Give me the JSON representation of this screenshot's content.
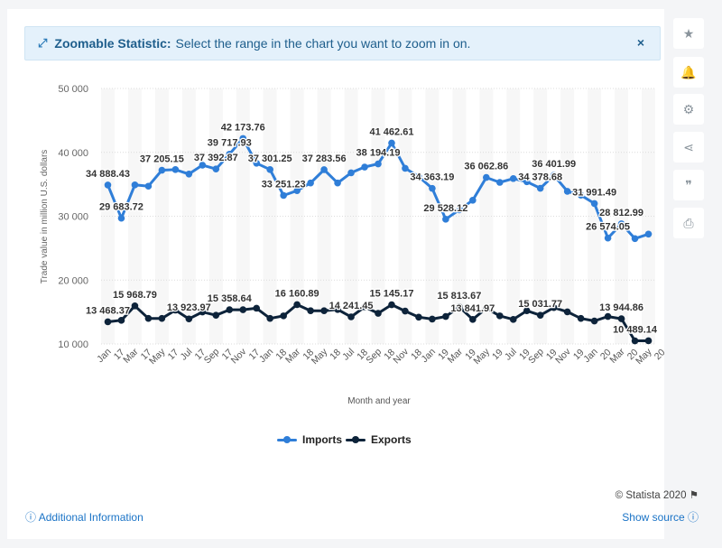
{
  "banner": {
    "title": "Zoomable Statistic:",
    "text": "Select the range in the chart you want to zoom in on.",
    "close": "×"
  },
  "sidebar": {
    "star": "★",
    "bell": "🔔",
    "gear": "⚙",
    "share": "⋖",
    "quote": "❞",
    "print": "⎙"
  },
  "footer": {
    "copyright": "© Statista 2020",
    "flag": "⚑",
    "additional_info": "Additional Information",
    "show_source": "Show source"
  },
  "colors": {
    "imports": "#2f7ed8",
    "exports": "#0d233a"
  },
  "chart_data": {
    "type": "line",
    "title": "",
    "xlabel": "Month and year",
    "ylabel": "Trade value in million U.S. dollars",
    "ylim": [
      10000,
      50000
    ],
    "yticks": [
      10000,
      20000,
      30000,
      40000,
      50000
    ],
    "ytick_labels": [
      "10 000",
      "20 000",
      "30 000",
      "40 000",
      "50 000"
    ],
    "categories": [
      "Jan 17",
      "Feb 17",
      "Mar 17",
      "Apr 17",
      "May 17",
      "Jun 17",
      "Jul 17",
      "Aug 17",
      "Sep 17",
      "Oct 17",
      "Nov 17",
      "Dec 17",
      "Jan 18",
      "Feb 18",
      "Mar 18",
      "Apr 18",
      "May 18",
      "Jun 18",
      "Jul 18",
      "Aug 18",
      "Sep 18",
      "Oct 18",
      "Nov 18",
      "Dec 18",
      "Jan 19",
      "Feb 19",
      "Mar 19",
      "Apr 19",
      "May 19",
      "Jun 19",
      "Jul 19",
      "Aug 19",
      "Sep 19",
      "Oct 19",
      "Nov 19",
      "Dec 19",
      "Jan 20",
      "Feb 20",
      "Mar 20",
      "Apr 20",
      "May 20"
    ],
    "xtick_labels": [
      [
        "Jan",
        "17"
      ],
      [
        "Mar",
        "17"
      ],
      [
        "May",
        "17"
      ],
      [
        "Jul",
        "17"
      ],
      [
        "Sep",
        "17"
      ],
      [
        "Nov",
        "17"
      ],
      [
        "Jan",
        "18"
      ],
      [
        "Mar",
        "18"
      ],
      [
        "May",
        "18"
      ],
      [
        "Jul",
        "18"
      ],
      [
        "Sep",
        "18"
      ],
      [
        "Nov",
        "18"
      ],
      [
        "Jan",
        "19"
      ],
      [
        "Mar",
        "19"
      ],
      [
        "May",
        "19"
      ],
      [
        "Jul",
        "19"
      ],
      [
        "Sep",
        "19"
      ],
      [
        "Nov",
        "19"
      ],
      [
        "Jan",
        "20"
      ],
      [
        "Mar",
        "20"
      ],
      [
        "May",
        "20"
      ]
    ],
    "grid": true,
    "legend": "bottom-center",
    "series": [
      {
        "name": "Imports",
        "values": [
          34888.43,
          29683.72,
          34900,
          34700,
          37205.15,
          37300,
          36600,
          38000,
          37392.87,
          39717.93,
          42173.76,
          38300,
          37301.25,
          33251.23,
          34000,
          35200,
          37283.56,
          35200,
          36800,
          37700,
          38194.19,
          41462.61,
          37500,
          36200,
          34363.19,
          29528.12,
          31000,
          32500,
          36062.86,
          35300,
          35900,
          35400,
          34378.68,
          36401.99,
          33900,
          33300,
          31991.49,
          26574.05,
          28812.99,
          26500,
          27200
        ],
        "labels": [
          "34 888.43",
          "29 683.72",
          "",
          "",
          "37 205.15",
          "",
          "",
          "",
          "37 392.87",
          "39 717.93",
          "42 173.76",
          "",
          "37 301.25",
          "33 251.23",
          "",
          "",
          "37 283.56",
          "",
          "",
          "",
          "38 194.19",
          "41 462.61",
          "",
          "",
          "34 363.19",
          "29 528.12",
          "",
          "",
          "36 062.86",
          "",
          "",
          "",
          "34 378.68",
          "36 401.99",
          "",
          "",
          "31 991.49",
          "26 574.05",
          "28 812.99",
          "",
          ""
        ]
      },
      {
        "name": "Exports",
        "values": [
          13468.37,
          13700,
          15968.79,
          14000,
          14000,
          15300,
          13923.97,
          15000,
          14500,
          15358.64,
          15358.64,
          15600,
          14000,
          14400,
          16160.89,
          15200,
          15200,
          15400,
          14241.45,
          15800,
          14800,
          16145.17,
          15145.17,
          14200,
          13900,
          14300,
          15813.67,
          13841.97,
          15600,
          14400,
          13841.97,
          15200,
          14500,
          15700,
          15031.77,
          14000,
          13600,
          14300,
          13944.86,
          10489.14,
          10500
        ],
        "labels": [
          "13 468.37",
          "",
          "15 968.79",
          "",
          "",
          "",
          "13 923.97",
          "",
          "",
          "15 358.64",
          "",
          "",
          "",
          "",
          "16 160.89",
          "",
          "",
          "",
          "14 241.45",
          "",
          "",
          "15 145.17",
          "",
          "",
          "",
          "",
          "15 813.67",
          "13 841.97",
          "",
          "",
          "",
          "",
          "15 031.77",
          "",
          "",
          "",
          "",
          "",
          "13 944.86",
          "10 489.14",
          ""
        ]
      }
    ]
  }
}
